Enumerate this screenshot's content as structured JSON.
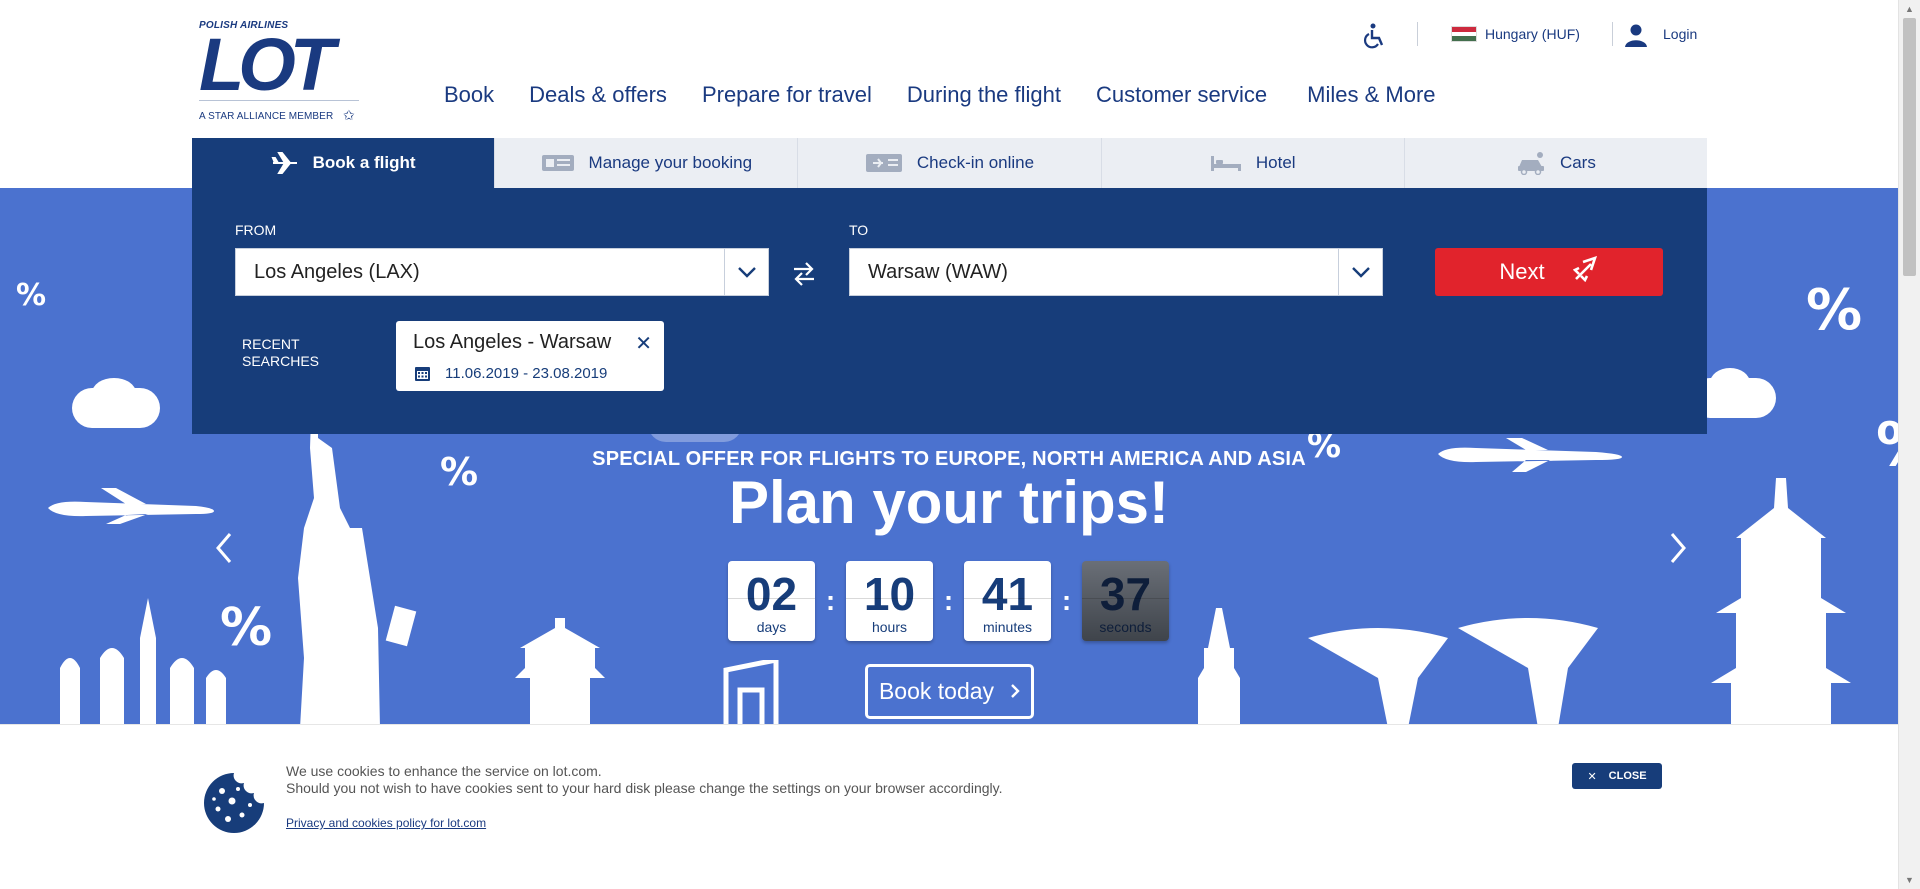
{
  "logo": {
    "tagline_top": "POLISH AIRLINES",
    "brand": "LOT",
    "tagline_bottom": "A STAR ALLIANCE MEMBER"
  },
  "topbar": {
    "accessibility_icon": "wheelchair-icon",
    "country": "Hungary (HUF)",
    "flag_colors": [
      "#cd2a3e",
      "#ffffff",
      "#436f4d"
    ],
    "login": "Login"
  },
  "nav": [
    "Book",
    "Deals & offers",
    "Prepare for travel",
    "During the flight",
    "Customer service",
    "Miles & More"
  ],
  "tabs": [
    {
      "label": "Book a flight",
      "icon": "plane-icon",
      "active": true
    },
    {
      "label": "Manage your booking",
      "icon": "ticket-icon",
      "active": false
    },
    {
      "label": "Check-in online",
      "icon": "boarding-pass-icon",
      "active": false
    },
    {
      "label": "Hotel",
      "icon": "bed-icon",
      "active": false
    },
    {
      "label": "Cars",
      "icon": "car-icon",
      "active": false
    }
  ],
  "search": {
    "from_label": "FROM",
    "from_value": "Los Angeles (LAX)",
    "to_label": "TO",
    "to_value": "Warsaw (WAW)",
    "next_label": "Next",
    "recent_label_1": "RECENT",
    "recent_label_2": "SEARCHES",
    "recent_route": "Los Angeles - Warsaw",
    "recent_dates": "11.06.2019 - 23.08.2019"
  },
  "promo": {
    "subtitle": "SPECIAL OFFER FOR FLIGHTS TO EUROPE, NORTH AMERICA AND ASIA",
    "title": "Plan your trips!",
    "countdown": [
      {
        "value": "02",
        "unit": "days"
      },
      {
        "value": "10",
        "unit": "hours"
      },
      {
        "value": "41",
        "unit": "minutes"
      },
      {
        "value": "37",
        "unit": "seconds"
      }
    ],
    "book_today": "Book today"
  },
  "cookie": {
    "line1": "We use cookies to enhance the service on lot.com.",
    "line2": "Should you not wish to have cookies sent to your hard disk please change the settings on your browser accordingly.",
    "policy_link": "Privacy and cookies policy for lot.com",
    "close": "CLOSE"
  },
  "colors": {
    "brand_navy": "#173d7a",
    "hero_blue": "#4b72cf",
    "cta_red": "#e1232c"
  }
}
